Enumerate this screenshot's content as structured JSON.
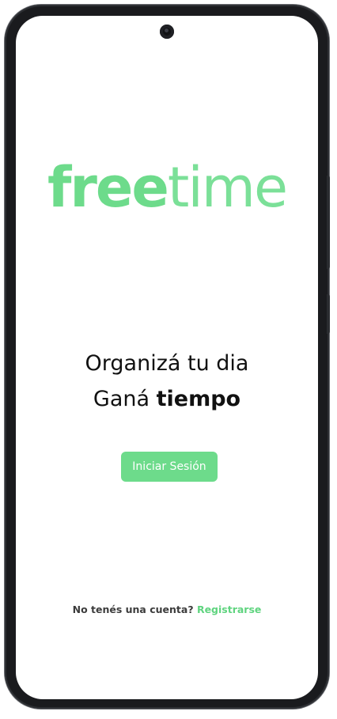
{
  "app": {
    "logo_bold": "free",
    "logo_light": "time"
  },
  "welcome": {
    "line1": "Organizá tu dia",
    "line2_prefix": "Ganá",
    "line2_bold": "tiempo"
  },
  "actions": {
    "login_label": "Iniciar Sesión"
  },
  "footer": {
    "question": "No tenés una cuenta?",
    "register_label": "Registrarse"
  },
  "colors": {
    "brand_green": "#6ddb8b",
    "text_dark": "#111111",
    "text_muted": "#3c3c3c",
    "frame": "#1a1b1e"
  },
  "icons": {
    "camera": "front-camera-icon"
  }
}
